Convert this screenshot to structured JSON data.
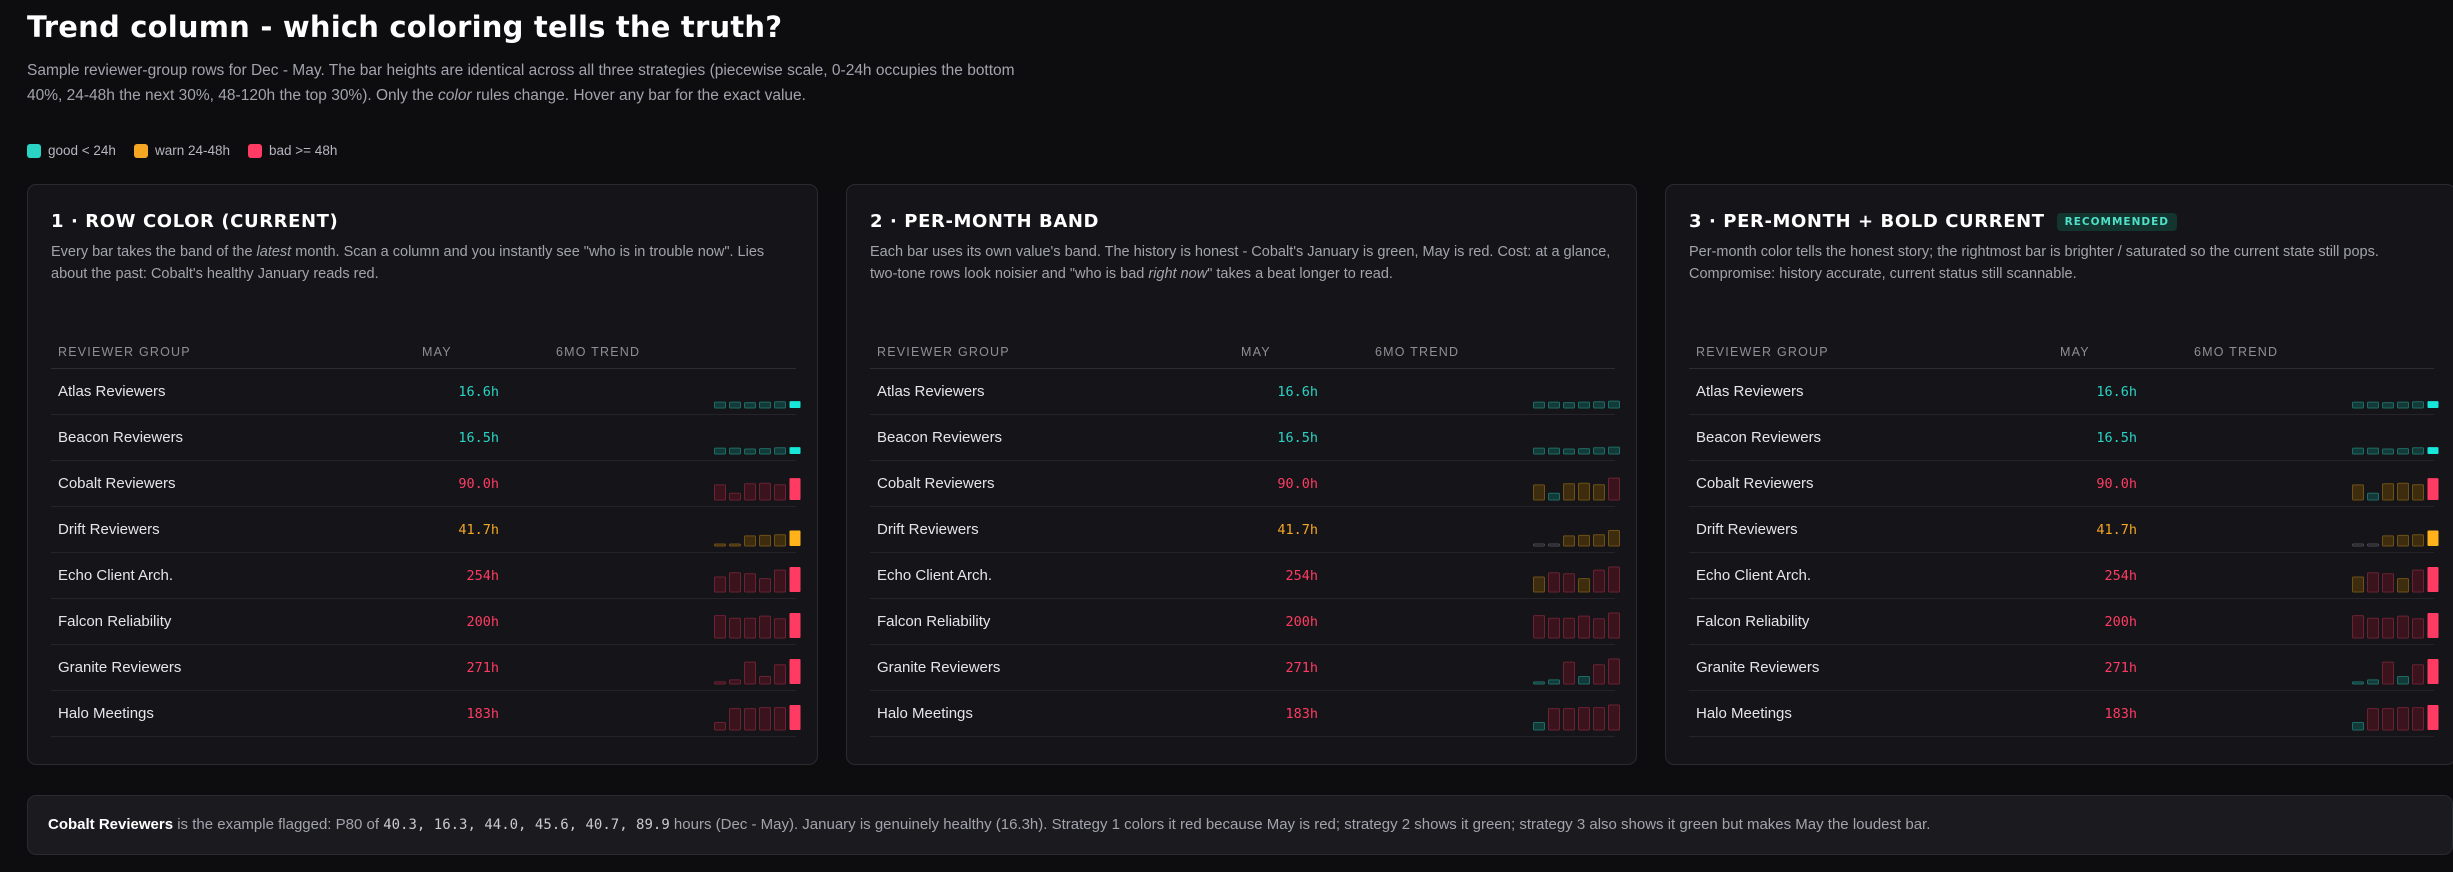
{
  "header": {
    "title": "Trend column - which coloring tells the truth?",
    "subtitle_a": "Sample reviewer-group rows for Dec - May. The bar heights are identical across all three strategies (piecewise scale, 0-24h occupies the bottom 40%, 24-48h the next 30%, 48-120h the top 30%). Only the ",
    "subtitle_em": "color",
    "subtitle_b": " rules change. Hover any bar for the exact value."
  },
  "legend": [
    {
      "label": "good < 24h",
      "color": "#2ad4c4"
    },
    {
      "label": "warn 24-48h",
      "color": "#f5a623"
    },
    {
      "label": "bad >= 48h",
      "color": "#ff3b63"
    }
  ],
  "colors": {
    "good": "#2ad4c4",
    "warn": "#f5a623",
    "bad": "#ff3b63",
    "good_bright": "#18e6d8",
    "warn_bright": "#ffb21a",
    "bad_bright": "#ff3b63"
  },
  "panels": [
    {
      "title": "1 · ROW COLOR (CURRENT)",
      "badge": "",
      "desc_a": "Every bar takes the band of the ",
      "desc_em": "latest",
      "desc_b": " month. Scan a column and you instantly see \"who is in trouble now\". Lies about the past: Cobalt's healthy January reads red.",
      "strategy": "row"
    },
    {
      "title": "2 · PER-MONTH BAND",
      "badge": "",
      "desc_a": "Each bar uses its own value's band. The history is honest - Cobalt's January is green, May is red. Cost: at a glance, two-tone rows look noisier and \"who is bad ",
      "desc_em": "right now",
      "desc_b": "\" takes a beat longer to read.",
      "strategy": "month"
    },
    {
      "title": "3 · PER-MONTH + BOLD CURRENT",
      "badge": "RECOMMENDED",
      "desc_a": "Per-month color tells the honest story; the rightmost bar is brighter / saturated so the current state still pops. Compromise: history accurate, current status still scannable.",
      "desc_em": "",
      "desc_b": "",
      "strategy": "bold"
    }
  ],
  "table": {
    "col_group": "REVIEWER GROUP",
    "col_may": "MAY",
    "col_trend": "6MO TREND",
    "rows": [
      {
        "name": "Atlas Reviewers",
        "may": "16.6h",
        "band": "good",
        "trend": [
          14,
          14,
          13,
          14,
          15,
          16.6
        ]
      },
      {
        "name": "Beacon Reviewers",
        "may": "16.5h",
        "band": "good",
        "trend": [
          14,
          14,
          12,
          13,
          15,
          16.5
        ]
      },
      {
        "name": "Cobalt Reviewers",
        "may": "90.0h",
        "band": "bad",
        "trend": [
          40.3,
          16.3,
          44.0,
          45.6,
          40.7,
          89.9
        ]
      },
      {
        "name": "Drift Reviewers",
        "may": "41.7h",
        "band": "warn",
        "trend": [
          2,
          2,
          24.5,
          26,
          28,
          41.7
        ]
      },
      {
        "name": "Echo Client Arch.",
        "may": "254h",
        "band": "bad",
        "trend": [
          40,
          65,
          55,
          35,
          90,
          254
        ]
      },
      {
        "name": "Falcon Reliability",
        "may": "200h",
        "band": "bad",
        "trend": [
          95,
          70,
          70,
          90,
          65,
          200
        ]
      },
      {
        "name": "Granite Reviewers",
        "may": "271h",
        "band": "bad",
        "trend": [
          5,
          10,
          90,
          18,
          65,
          271
        ]
      },
      {
        "name": "Halo Meetings",
        "may": "183h",
        "band": "bad",
        "trend": [
          18,
          85,
          85,
          95,
          95,
          183
        ]
      }
    ]
  },
  "footer": {
    "bold": "Cobalt Reviewers",
    "t1": " is the example flagged: P80 of ",
    "values": "40.3, 16.3, 44.0, 45.6, 40.7, 89.9",
    "t2": " hours (Dec - May). January is genuinely healthy (16.3h). Strategy 1 colors it red because May is red; strategy 2 shows it green; strategy 3 also shows it green but makes May the loudest bar."
  }
}
